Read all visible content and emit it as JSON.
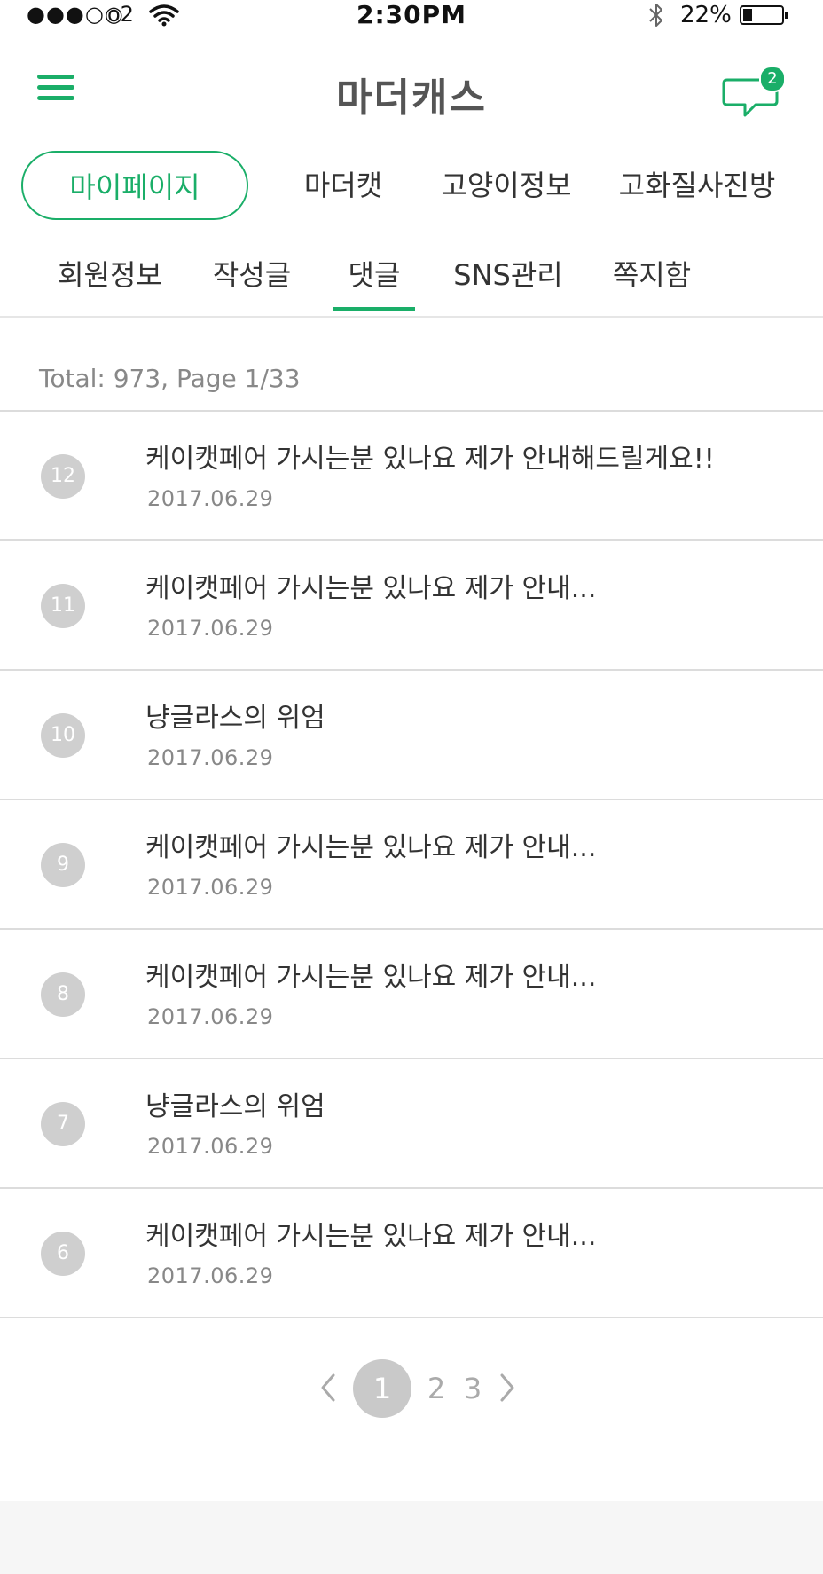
{
  "status_bar": {
    "signal": "●●●○○",
    "carrier": "o2",
    "time": "2:30PM",
    "battery_percent": "22%"
  },
  "header": {
    "logo": "마더캐스",
    "chat_badge_count": "2"
  },
  "main_tabs": [
    {
      "label": "마이페이지",
      "active": true
    },
    {
      "label": "마더캣",
      "active": false
    },
    {
      "label": "고양이정보",
      "active": false
    },
    {
      "label": "고화질사진방",
      "active": false
    }
  ],
  "sub_tabs": [
    {
      "label": "회원정보",
      "active": false
    },
    {
      "label": "작성글",
      "active": false
    },
    {
      "label": "댓글",
      "active": true
    },
    {
      "label": "SNS관리",
      "active": false
    },
    {
      "label": "쪽지함",
      "active": false
    }
  ],
  "summary": {
    "text": "Total: 973, Page 1/33"
  },
  "comments": [
    {
      "num": "12",
      "title": "케이캣페어 가시는분 있나요 제가 안내해드릴게요!!",
      "date": "2017.06.29"
    },
    {
      "num": "11",
      "title": "케이캣페어 가시는분 있나요 제가 안내...",
      "date": "2017.06.29"
    },
    {
      "num": "10",
      "title": "냥글라스의 위엄",
      "date": "2017.06.29"
    },
    {
      "num": "9",
      "title": "케이캣페어 가시는분 있나요 제가 안내...",
      "date": "2017.06.29"
    },
    {
      "num": "8",
      "title": "케이캣페어 가시는분 있나요 제가 안내...",
      "date": "2017.06.29"
    },
    {
      "num": "7",
      "title": "냥글라스의 위엄",
      "date": "2017.06.29"
    },
    {
      "num": "6",
      "title": "케이캣페어 가시는분 있나요 제가 안내...",
      "date": "2017.06.29"
    }
  ],
  "pagination": {
    "pages": [
      "1",
      "2",
      "3"
    ],
    "current": "1"
  },
  "colors": {
    "accent": "#1aae68",
    "badge_gray": "#cfcfcf",
    "text": "#333333",
    "muted": "#888888"
  }
}
